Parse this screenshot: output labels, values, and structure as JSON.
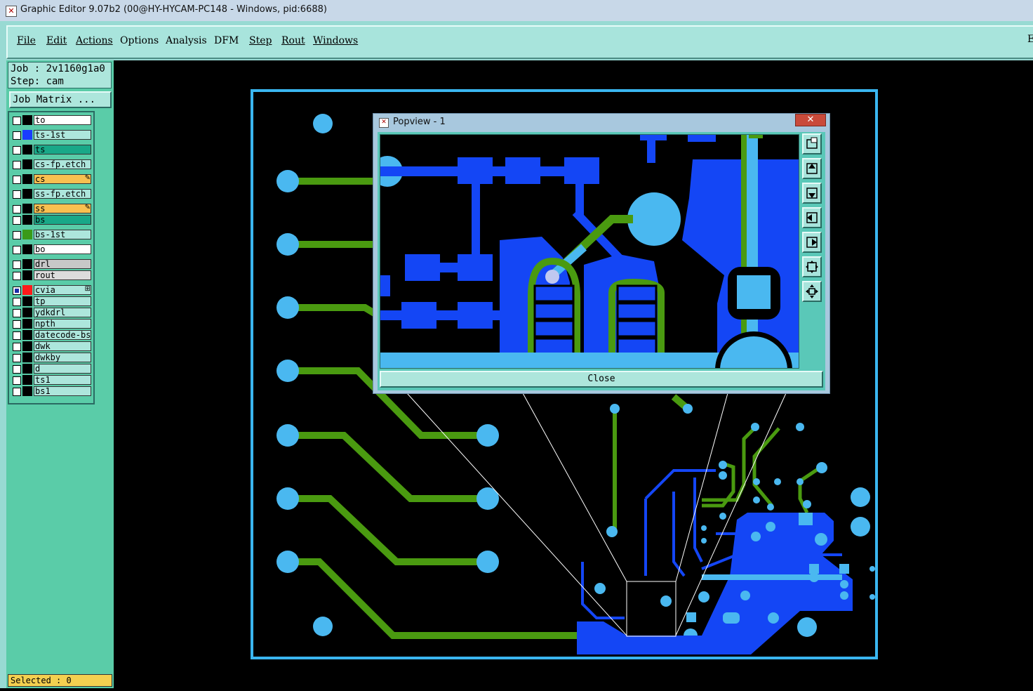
{
  "window": {
    "title": "Graphic Editor 9.07b2 (00@HY-HYCAM-PC148 - Windows, pid:6688)",
    "app_icon": "x-icon"
  },
  "menu": {
    "items": [
      {
        "label": "File"
      },
      {
        "label": "Edit"
      },
      {
        "label": "Actions"
      },
      {
        "label": "Options"
      },
      {
        "label": "Analysis"
      },
      {
        "label": "DFM"
      },
      {
        "label": "Step"
      },
      {
        "label": "Rout"
      },
      {
        "label": "Windows"
      }
    ],
    "right_edge_label": "E"
  },
  "job": {
    "job_line": "Job : 2v1160g1a0",
    "step_line": "Step: cam",
    "job_matrix_label": "Job Matrix ..."
  },
  "layers": [
    {
      "name": "to",
      "color": "#000000",
      "bg": "#ffffff"
    },
    {
      "name": "ts-1st",
      "color": "#1a3cff",
      "bg": "#ade6dc"
    },
    {
      "name": "ts",
      "color": "#000000",
      "bg": "#19a888"
    },
    {
      "name": "cs-fp.etch",
      "color": "#000000",
      "bg": "#ade6dc"
    },
    {
      "name": "cs",
      "color": "#000000",
      "bg": "#f8c050",
      "mark": "✎"
    },
    {
      "name": "ss-fp.etch",
      "color": "#000000",
      "bg": "#ade6dc"
    },
    {
      "name": "ss",
      "color": "#000000",
      "bg": "#f8c050",
      "mark": "✎"
    },
    {
      "name": "bs",
      "color": "#000000",
      "bg": "#19a888"
    },
    {
      "name": "bs-1st",
      "color": "#3a9a18",
      "bg": "#ade6dc"
    },
    {
      "name": "bo",
      "color": "#000000",
      "bg": "#ffffff"
    },
    {
      "name": "drl",
      "color": "#000000",
      "bg": "#c8c8c8"
    },
    {
      "name": "rout",
      "color": "#000000",
      "bg": "#dcdcdc"
    },
    {
      "name": "cvia",
      "color": "#ff1a1a",
      "bg": "#ade6dc",
      "mark": "⊞"
    },
    {
      "name": "tp",
      "color": "#000000",
      "bg": "#ade6dc"
    },
    {
      "name": "ydkdrl",
      "color": "#000000",
      "bg": "#ade6dc"
    },
    {
      "name": "npth",
      "color": "#000000",
      "bg": "#ade6dc"
    },
    {
      "name": "datecode-bs",
      "color": "#000000",
      "bg": "#ade6dc"
    },
    {
      "name": "dwk",
      "color": "#000000",
      "bg": "#ade6dc"
    },
    {
      "name": "dwkby",
      "color": "#000000",
      "bg": "#ade6dc"
    },
    {
      "name": "d",
      "color": "#000000",
      "bg": "#ade6dc"
    },
    {
      "name": "ts1",
      "color": "#000000",
      "bg": "#ade6dc"
    },
    {
      "name": "bs1",
      "color": "#000000",
      "bg": "#ade6dc"
    }
  ],
  "status": {
    "selected": "Selected : 0"
  },
  "popview": {
    "title": "Popview - 1",
    "close_label": "Close",
    "title_close_glyph": "✕",
    "tools": [
      "window-mode-icon",
      "pan-up-icon",
      "pan-down-icon",
      "pan-left-icon",
      "pan-right-icon",
      "zoom-fit-icon",
      "zoom-home-icon"
    ]
  },
  "colors": {
    "board_outline": "#3ab6f0",
    "copper_blue": "#1446f5",
    "copper_green": "#4a9a10",
    "pad_light": "#4ab8f0"
  }
}
